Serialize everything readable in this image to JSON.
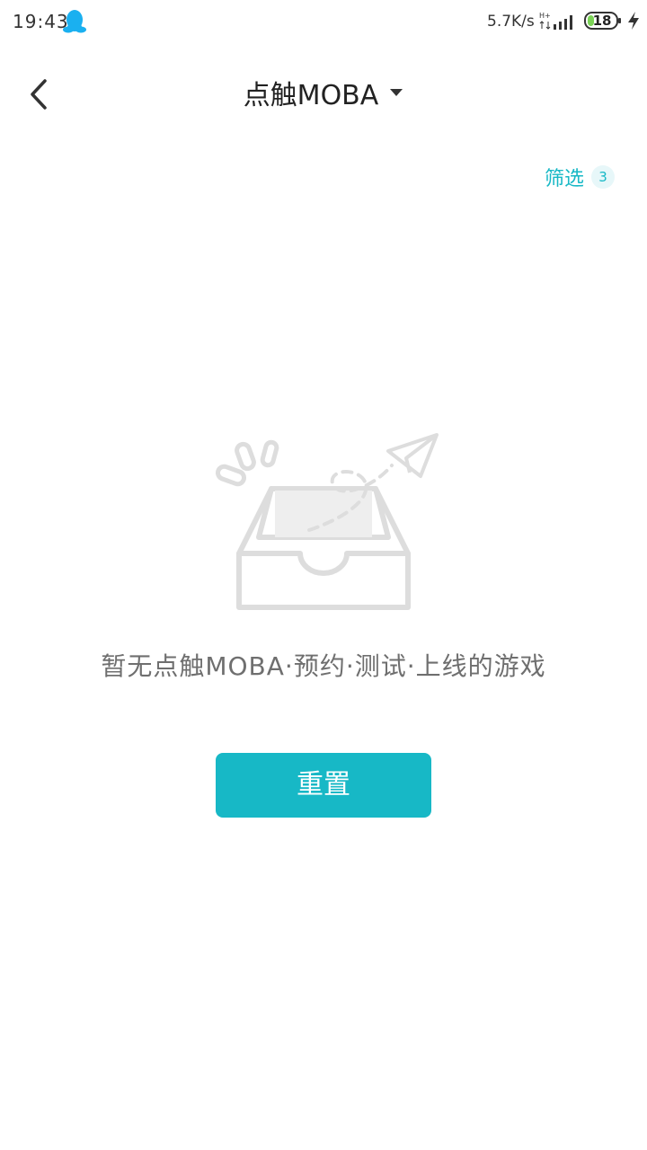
{
  "status_bar": {
    "time": "19:43",
    "net_speed": "5.7K/s",
    "battery": "18",
    "icons": [
      "qq-penguin-icon",
      "network-type-icon",
      "signal-icon",
      "battery-icon",
      "charging-icon"
    ]
  },
  "header": {
    "title": "点触MOBA",
    "back_icon": "chevron-left-icon",
    "dropdown_icon": "caret-down-icon"
  },
  "filter": {
    "label": "筛选",
    "count": "3"
  },
  "empty_state": {
    "icon": "empty-inbox-icon",
    "message": "暂无点触MOBA·预约·测试·上线的游戏"
  },
  "actions": {
    "reset_label": "重置"
  },
  "colors": {
    "accent": "#17b8c6",
    "qq_blue": "#1ab0f0",
    "battery_green": "#7bd356",
    "text_primary": "#222222",
    "text_secondary": "#6f6f6f",
    "illustration_gray": "#dddddd"
  }
}
